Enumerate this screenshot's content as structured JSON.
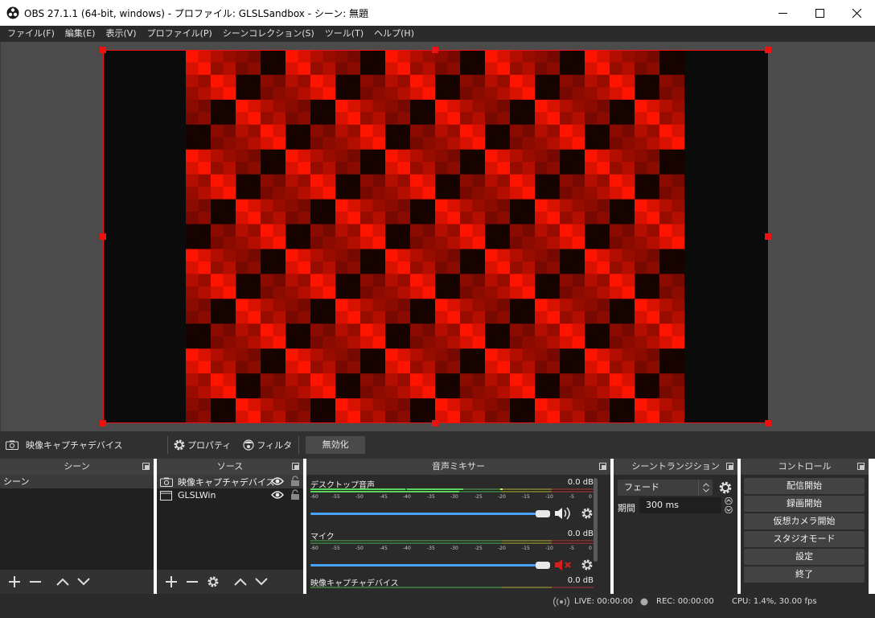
{
  "window": {
    "title": "OBS 27.1.1 (64-bit, windows) - プロファイル: GLSLSandbox - シーン: 無題",
    "app_icon": "obs-logo-icon",
    "controls": [
      "minimize-icon",
      "maximize-icon",
      "close-icon"
    ]
  },
  "menu": [
    {
      "label": "ファイル(F)"
    },
    {
      "label": "編集(E)"
    },
    {
      "label": "表示(V)"
    },
    {
      "label": "プロファイル(P)"
    },
    {
      "label": "シーンコレクション(S)"
    },
    {
      "label": "ツール(T)"
    },
    {
      "label": "ヘルプ(H)"
    }
  ],
  "colors": {
    "accent_red": "#ff1a0a",
    "selection": "#ee1111",
    "volume_blue": "#4aa3ff",
    "meter_green": "#4ec04e",
    "meter_yellow": "#c8c83a",
    "meter_red": "#c83a3a"
  },
  "source_toolbar": {
    "source_name": "映像キャプチャデバイス",
    "properties": "プロパティ",
    "filters": "フィルタ",
    "disable": "無効化"
  },
  "scenes": {
    "title": "シーン",
    "items": [
      "シーン"
    ]
  },
  "sources": {
    "title": "ソース",
    "items": [
      {
        "label": "映像キャプチャデバイス",
        "icon": "camera-icon"
      },
      {
        "label": "GLSLWin",
        "icon": "window-icon"
      }
    ]
  },
  "mixer": {
    "title": "音声ミキサー",
    "ticks": [
      "-60",
      "-55",
      "-50",
      "-45",
      "-40",
      "-35",
      "-30",
      "-25",
      "-20",
      "-15",
      "-10",
      "-5",
      "0"
    ],
    "channels": [
      {
        "name": "デスクトップ音声",
        "db": "0.0 dB",
        "volume": 1.0,
        "muted": false
      },
      {
        "name": "マイク",
        "db": "0.0 dB",
        "volume": 1.0,
        "muted": true
      },
      {
        "name": "映像キャプチャデバイス",
        "db": "0.0 dB"
      }
    ]
  },
  "transition": {
    "title": "シーントランジション",
    "type": "フェード",
    "duration_label": "期間",
    "duration": "300 ms"
  },
  "controls": {
    "title": "コントロール",
    "buttons": [
      "配信開始",
      "録画開始",
      "仮想カメラ開始",
      "スタジオモード",
      "設定",
      "終了"
    ]
  },
  "status": {
    "live": "LIVE: 00:00:00",
    "rec": "REC: 00:00:00",
    "cpu": "CPU: 1.4%, 30.00 fps"
  }
}
